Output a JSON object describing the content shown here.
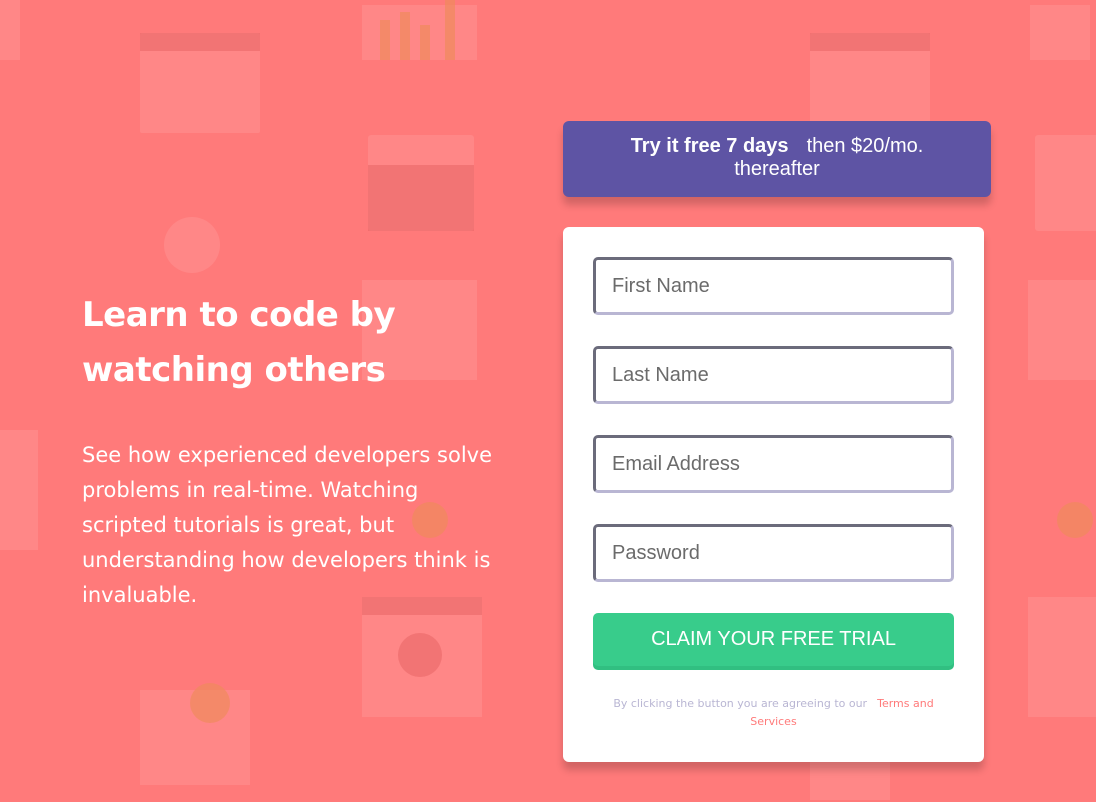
{
  "page": {
    "background_color": "#ff7a7a",
    "accent_purple": "#5e54a4",
    "accent_green": "#38cc8b"
  },
  "intro": {
    "heading": "Learn to code by watching others",
    "body": "See how experienced developers solve problems in real-time. Watching scripted tutorials is great, but understanding how developers think is invaluable."
  },
  "promo": {
    "strong": "Try it free 7 days",
    "rest": "then $20/mo. thereafter"
  },
  "form": {
    "first_name_placeholder": "First Name",
    "last_name_placeholder": "Last Name",
    "email_placeholder": "Email Address",
    "password_placeholder": "Password",
    "submit_label": "CLAIM YOUR FREE TRIAL",
    "terms_text": "By clicking the button you are agreeing to our",
    "terms_link": "Terms and Services"
  }
}
